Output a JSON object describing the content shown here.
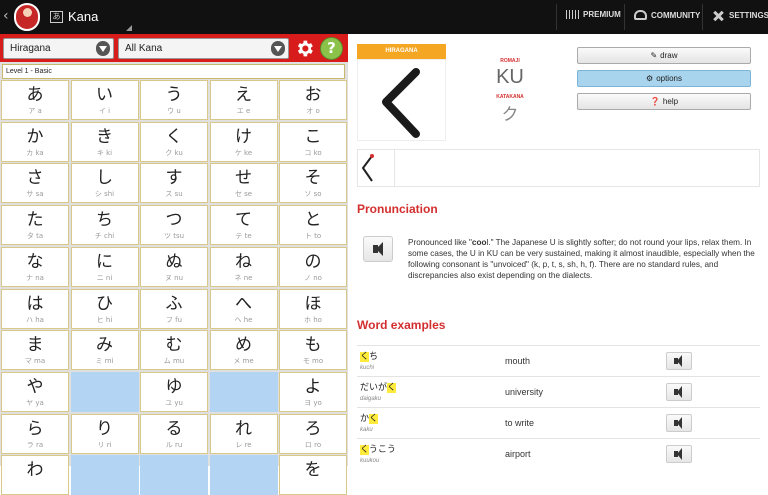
{
  "topbar": {
    "title": "Kana",
    "actions": [
      {
        "label": "PREMIUM",
        "icon": "premium-bars-icon"
      },
      {
        "label": "COMMUNITY",
        "icon": "community-icon"
      },
      {
        "label": "SETTINGS",
        "icon": "settings-tools-icon"
      }
    ]
  },
  "left": {
    "script_select": "Hiragana",
    "set_select": "All Kana",
    "level": "Level 1 - Basic",
    "grid": [
      [
        {
          "k": "あ",
          "r": "ア a"
        },
        {
          "k": "い",
          "r": "イ i"
        },
        {
          "k": "う",
          "r": "ウ u"
        },
        {
          "k": "え",
          "r": "エ e"
        },
        {
          "k": "お",
          "r": "オ o"
        }
      ],
      [
        {
          "k": "か",
          "r": "カ ka"
        },
        {
          "k": "き",
          "r": "キ ki"
        },
        {
          "k": "く",
          "r": "ク ku"
        },
        {
          "k": "け",
          "r": "ケ ke"
        },
        {
          "k": "こ",
          "r": "コ ko"
        }
      ],
      [
        {
          "k": "さ",
          "r": "サ sa"
        },
        {
          "k": "し",
          "r": "シ shi"
        },
        {
          "k": "す",
          "r": "ス su"
        },
        {
          "k": "せ",
          "r": "セ se"
        },
        {
          "k": "そ",
          "r": "ソ so"
        }
      ],
      [
        {
          "k": "た",
          "r": "タ ta"
        },
        {
          "k": "ち",
          "r": "チ chi"
        },
        {
          "k": "つ",
          "r": "ツ tsu"
        },
        {
          "k": "て",
          "r": "テ te"
        },
        {
          "k": "と",
          "r": "ト to"
        }
      ],
      [
        {
          "k": "な",
          "r": "ナ na"
        },
        {
          "k": "に",
          "r": "ニ ni"
        },
        {
          "k": "ぬ",
          "r": "ヌ nu"
        },
        {
          "k": "ね",
          "r": "ネ ne"
        },
        {
          "k": "の",
          "r": "ノ no"
        }
      ],
      [
        {
          "k": "は",
          "r": "ハ ha"
        },
        {
          "k": "ひ",
          "r": "ヒ hi"
        },
        {
          "k": "ふ",
          "r": "フ fu"
        },
        {
          "k": "へ",
          "r": "ヘ he"
        },
        {
          "k": "ほ",
          "r": "ホ ho"
        }
      ],
      [
        {
          "k": "ま",
          "r": "マ ma"
        },
        {
          "k": "み",
          "r": "ミ mi"
        },
        {
          "k": "む",
          "r": "ム mu"
        },
        {
          "k": "め",
          "r": "メ me"
        },
        {
          "k": "も",
          "r": "モ mo"
        }
      ],
      [
        {
          "k": "や",
          "r": "ヤ ya"
        },
        null,
        {
          "k": "ゆ",
          "r": "ユ yu"
        },
        null,
        {
          "k": "よ",
          "r": "ヨ yo"
        }
      ],
      [
        {
          "k": "ら",
          "r": "ラ ra"
        },
        {
          "k": "り",
          "r": "リ ri"
        },
        {
          "k": "る",
          "r": "ル ru"
        },
        {
          "k": "れ",
          "r": "レ re"
        },
        {
          "k": "ろ",
          "r": "ロ ro"
        }
      ],
      [
        {
          "k": "わ",
          "r": ""
        },
        null,
        null,
        null,
        {
          "k": "を",
          "r": ""
        }
      ]
    ]
  },
  "right": {
    "card_label": "HIRAGANA",
    "romaji_label": "ROMAJI",
    "romaji": "KU",
    "katakana_label": "KATAKANA",
    "katakana": "ク",
    "buttons": {
      "draw": "draw",
      "options": "options",
      "help": "help"
    },
    "pronunciation_heading": "Pronunciation",
    "pronunciation_pre": "Pronounced like \"",
    "pronunciation_bold": "coo",
    "pronunciation_post": "l.\" The Japanese U is slightly softer; do not round your lips, relax them. In some cases, the U in KU can be very sustained, making it almost inaudible, especially when the following consonant is \"unvoiced\" (k, p, t, s, sh, h, f). There are no standard rules, and discrepancies also exist depending on the dialects.",
    "words_heading": "Word examples",
    "words": [
      {
        "pre": "",
        "hl": "く",
        "post": "ち",
        "romaji": "kuchi",
        "en": "mouth"
      },
      {
        "pre": "だいが",
        "hl": "く",
        "post": "",
        "romaji": "daigaku",
        "en": "university"
      },
      {
        "pre": "か",
        "hl": "く",
        "post": "",
        "romaji": "kaku",
        "en": "to write"
      },
      {
        "pre": "",
        "hl": "く",
        "post": "うこう",
        "romaji": "kuukou",
        "en": "airport"
      }
    ]
  }
}
